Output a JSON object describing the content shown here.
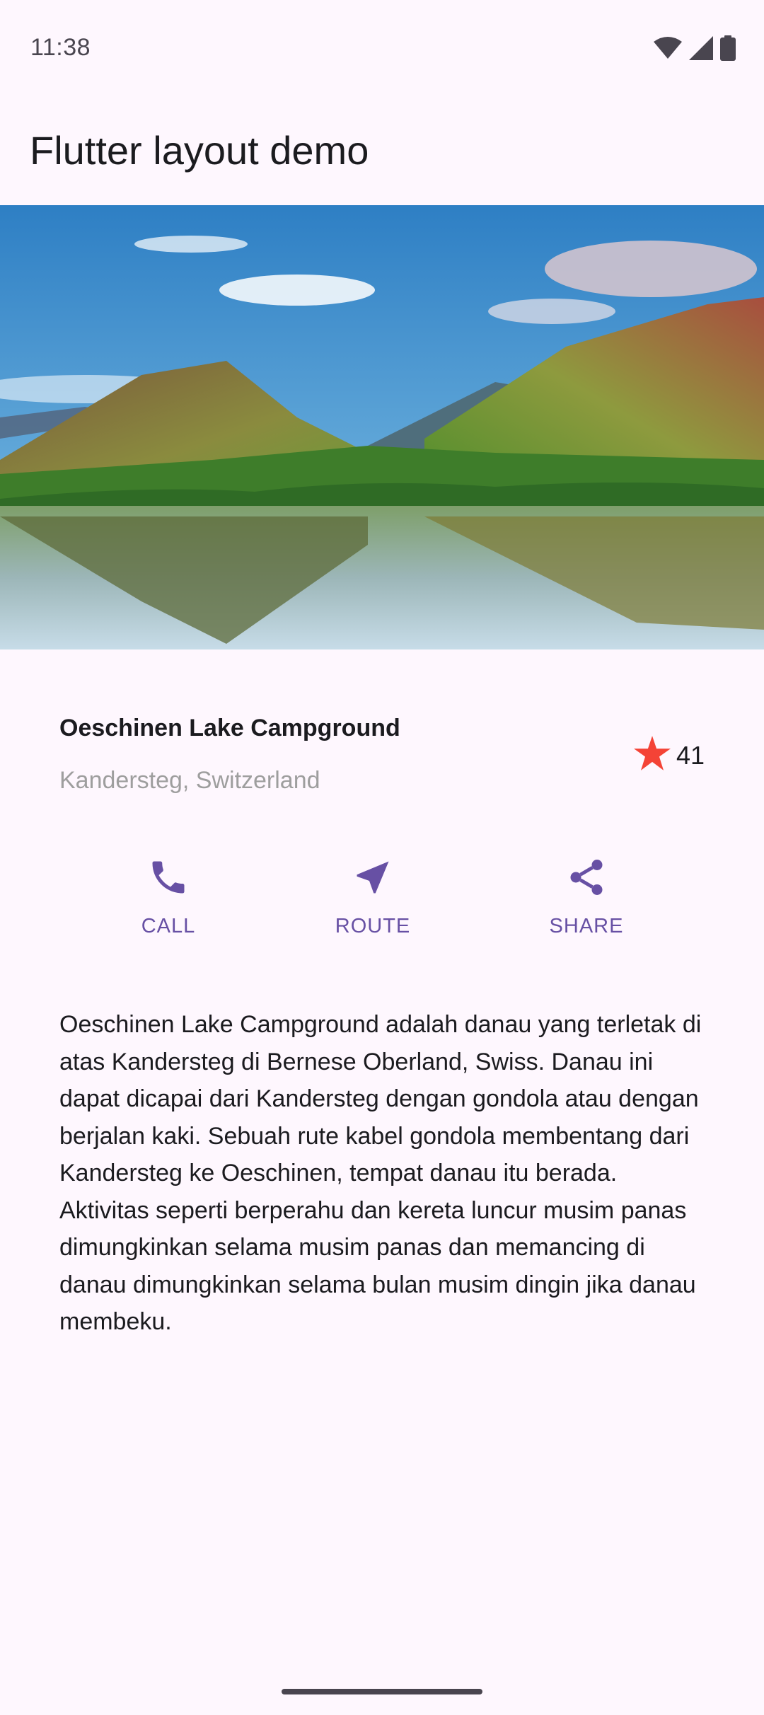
{
  "status_bar": {
    "time": "11:38",
    "icons": [
      "wifi-icon",
      "signal-icon",
      "battery-icon"
    ]
  },
  "app_bar": {
    "title": "Flutter layout demo"
  },
  "hero_image": {
    "subject": "mountain-lake-landscape"
  },
  "title_section": {
    "name": "Oeschinen Lake Campground",
    "location": "Kandersteg, Switzerland",
    "rating_icon": "star-icon",
    "rating_count": "41"
  },
  "actions": [
    {
      "label": "CALL",
      "icon": "phone-icon"
    },
    {
      "label": "ROUTE",
      "icon": "navigation-icon"
    },
    {
      "label": "SHARE",
      "icon": "share-icon"
    }
  ],
  "description": "Oeschinen Lake Campground adalah danau yang terletak di atas Kandersteg di Bernese Oberland, Swiss. Danau ini dapat dicapai dari Kandersteg dengan gondola atau dengan berjalan kaki. Sebuah rute kabel gondola membentang dari Kandersteg ke Oeschinen, tempat danau itu berada. Aktivitas seperti berperahu dan kereta luncur musim panas dimungkinkan selama musim panas dan memancing di danau dimungkinkan selama bulan musim dingin jika danau membeku.",
  "colors": {
    "background": "#FEF7FE",
    "accent": "#6750A4",
    "star": "#F44336",
    "subtitle": "#9E9E9E"
  }
}
